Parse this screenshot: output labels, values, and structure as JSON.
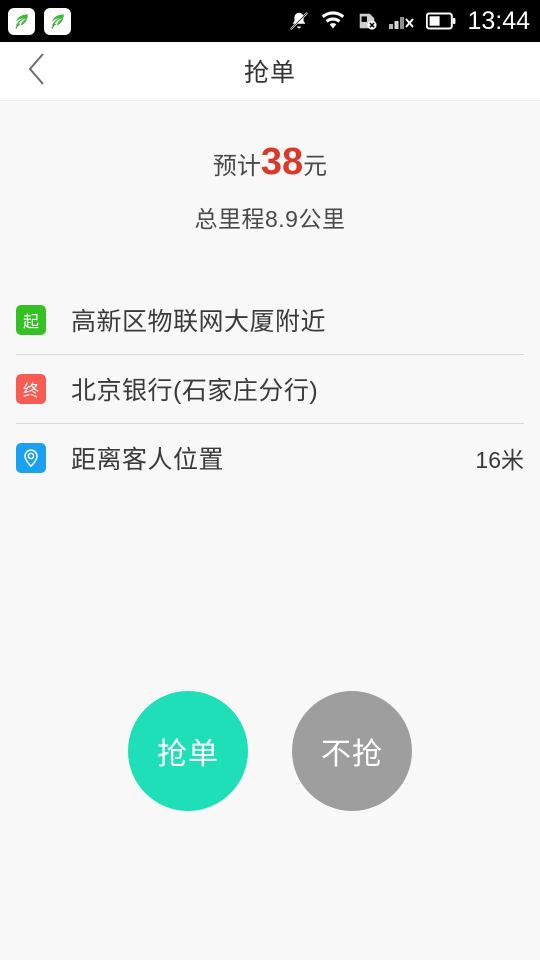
{
  "status_bar": {
    "time": "13:44",
    "notification_icons": [
      "app-leaf-icon",
      "app-leaf-icon"
    ],
    "system_icons": [
      "mute-bell-icon",
      "wifi-icon",
      "sdcard-off-icon",
      "signal-off-icon",
      "battery-icon"
    ],
    "background_color": "#000000"
  },
  "nav": {
    "back_icon": "chevron-left-icon",
    "title": "抢单"
  },
  "fare": {
    "prefix": "预计",
    "amount": "38",
    "unit": "元",
    "amount_color": "#d9392b",
    "distance_text": "总里程8.9公里"
  },
  "rows": [
    {
      "badge_text": "起",
      "badge_color": "#35c124",
      "icon": "start-point-badge",
      "label": "高新区物联网大厦附近",
      "value": ""
    },
    {
      "badge_text": "终",
      "badge_color": "#f75b52",
      "icon": "end-point-badge",
      "label": "北京银行(石家庄分行)",
      "value": ""
    },
    {
      "badge_text": "",
      "badge_color": "#1ba1f2",
      "icon": "location-pin-icon",
      "label": "距离客人位置",
      "value": "16米"
    }
  ],
  "actions": {
    "accept_label": "抢单",
    "accept_color": "#1fdfb8",
    "reject_label": "不抢",
    "reject_color": "#9e9e9e"
  }
}
